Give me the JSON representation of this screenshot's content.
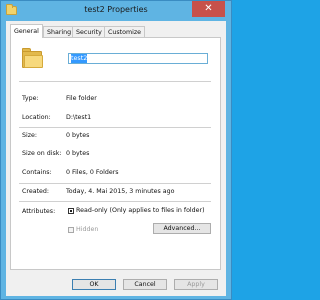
{
  "window": {
    "title": "test2 Properties",
    "close_glyph": "✕"
  },
  "tabs": [
    {
      "label": "General",
      "active": true
    },
    {
      "label": "Sharing",
      "active": false
    },
    {
      "label": "Security",
      "active": false
    },
    {
      "label": "Customize",
      "active": false
    }
  ],
  "general": {
    "name_value": "test2",
    "rows": [
      {
        "label": "Type:",
        "value": "File folder"
      },
      {
        "label": "Location:",
        "value": "D:\\test1"
      },
      {
        "label": "Size:",
        "value": "0 bytes"
      },
      {
        "label": "Size on disk:",
        "value": "0 bytes"
      },
      {
        "label": "Contains:",
        "value": "0 Files, 0 Folders"
      },
      {
        "label": "Created:",
        "value": "Today, 4. Mai 2015, 3 minutes ago"
      }
    ],
    "attributes_label": "Attributes:",
    "readonly_label": "Read-only (Only applies to files in folder)",
    "hidden_label": "Hidden",
    "advanced_label": "Advanced..."
  },
  "footer": {
    "ok_label": "OK",
    "cancel_label": "Cancel",
    "apply_label": "Apply"
  },
  "icons": {
    "folder": "folder-icon",
    "app": "folder-icon",
    "close": "close-icon"
  },
  "colors": {
    "titlebar": "#5fb4e3",
    "close_button": "#c7514a",
    "selection": "#3399ff"
  }
}
